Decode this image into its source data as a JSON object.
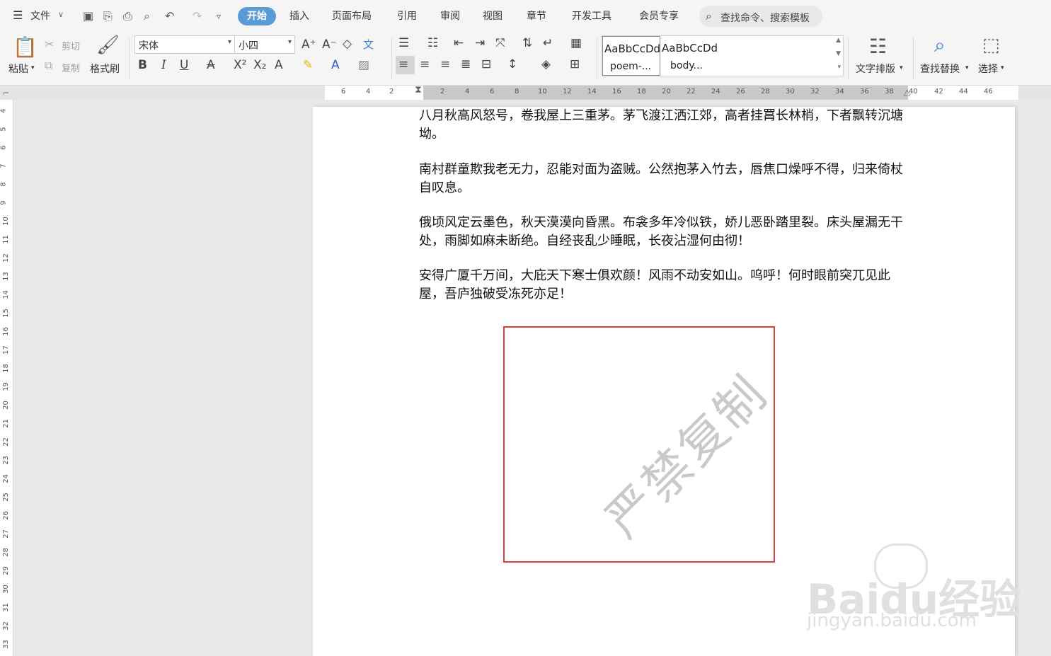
{
  "menubar": {
    "file_label": "文件",
    "tabs": [
      "开始",
      "插入",
      "页面布局",
      "引用",
      "审阅",
      "视图",
      "章节",
      "开发工具",
      "会员专享"
    ],
    "search_placeholder": "查找命令、搜索模板"
  },
  "ribbon": {
    "paste_label": "粘贴",
    "cut_label": "剪切",
    "copy_label": "复制",
    "format_painter_label": "格式刷",
    "font_name": "宋体",
    "font_size": "小四",
    "styles": [
      {
        "preview": "AaBbCcDd",
        "name": "poem-..."
      },
      {
        "preview": "AaBbCcDd",
        "name": "body..."
      }
    ],
    "text_layout_label": "文字排版",
    "find_replace_label": "查找替换",
    "select_label": "选择"
  },
  "ruler": {
    "h_ticks": [
      "6",
      "4",
      "2",
      "2",
      "4",
      "6",
      "8",
      "10",
      "12",
      "14",
      "16",
      "18",
      "20",
      "22",
      "24",
      "26",
      "28",
      "30",
      "32",
      "34",
      "36",
      "38",
      "40",
      "42",
      "44",
      "46"
    ],
    "v_ticks": [
      "4",
      "5",
      "6",
      "7",
      "8",
      "9",
      "10",
      "11",
      "12",
      "13",
      "14",
      "15",
      "16",
      "17",
      "18",
      "19",
      "20",
      "21",
      "22",
      "23",
      "24",
      "25",
      "26",
      "27",
      "28",
      "29",
      "30",
      "31",
      "32",
      "33"
    ]
  },
  "document": {
    "paragraphs": [
      "八月秋高风怒号，卷我屋上三重茅。茅飞渡江洒江郊，高者挂罥长林梢，下者飘转沉塘坳。",
      "南村群童欺我老无力，忍能对面为盗贼。公然抱茅入竹去，唇焦口燥呼不得，归来倚杖自叹息。",
      "俄顷风定云墨色，秋天漠漠向昏黑。布衾多年冷似铁，娇儿恶卧踏里裂。床头屋漏无干处，雨脚如麻未断绝。自经丧乱少睡眠，长夜沾湿何由彻！",
      "安得广厦千万间，大庇天下寒士俱欢颜！风雨不动安如山。呜呼！何时眼前突兀见此屋，吾庐独破受冻死亦足！"
    ],
    "watermark": "严禁复制"
  },
  "brand": {
    "logo_text": "Baidu经验",
    "url_text": "jingyan.baidu.com"
  },
  "colors": {
    "accent": "#5b9bd5",
    "frame_red": "#d9413e"
  }
}
